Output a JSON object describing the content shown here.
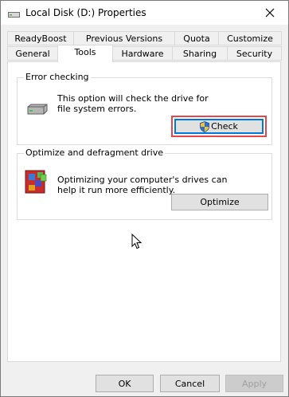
{
  "window": {
    "title": "Local Disk (D:) Properties",
    "icons": {
      "title": "drive-icon",
      "close": "close-icon"
    }
  },
  "tabs": {
    "row1": [
      "ReadyBoost",
      "Previous Versions",
      "Quota",
      "Customize"
    ],
    "row2": [
      "General",
      "Tools",
      "Hardware",
      "Sharing",
      "Security"
    ],
    "active": "Tools"
  },
  "error_checking": {
    "title": "Error checking",
    "description": "This option will check the drive for file system errors.",
    "button_label": "Check",
    "icons": {
      "section": "drive-icon",
      "button": "shield-icon"
    }
  },
  "optimize": {
    "title": "Optimize and defragment drive",
    "description": "Optimizing your computer's drives can help it run more efficiently.",
    "button_label": "Optimize",
    "icons": {
      "section": "defragment-icon"
    }
  },
  "footer": {
    "ok_label": "OK",
    "cancel_label": "Cancel",
    "apply_label": "Apply"
  },
  "colors": {
    "highlight": "#e8454a",
    "focus": "#0078d7"
  }
}
